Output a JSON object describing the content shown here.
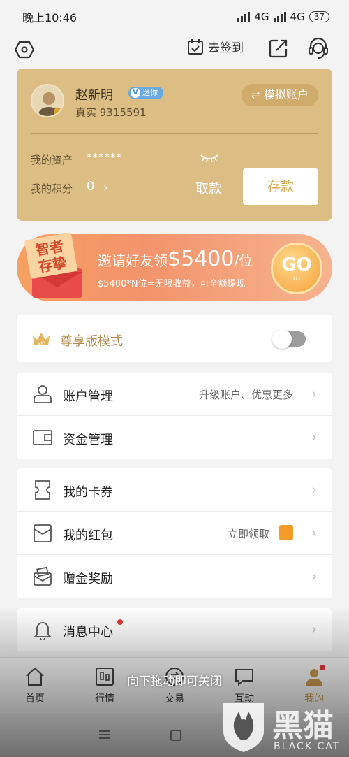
{
  "status_bar": {
    "time": "晚上10:46",
    "network1": "4G",
    "network2": "4G",
    "battery": "37"
  },
  "top_nav": {
    "sign_in_label": "去签到"
  },
  "account": {
    "name": "赵新明",
    "badge": "迷你",
    "badge_v": "V",
    "id_text": "真实 9315591",
    "simulated_label": "⇌ 模拟账户",
    "asset_label": "我的资产",
    "asset_value": "******",
    "points_label": "我的积分",
    "points_value": "0",
    "withdraw_label": "取款",
    "deposit_label": "存款"
  },
  "banner": {
    "badge_line1": "智者",
    "badge_line2": "存挚",
    "title_prefix": "邀请好友领",
    "title_amount": "$5400",
    "title_suffix": "/位",
    "subtitle": "$5400*N位=无限收益，可全额提现",
    "go_label": "GO",
    "go_arrows": "›››"
  },
  "vip_mode": {
    "label": "尊享版模式",
    "crown_text": "VIP",
    "enabled": false
  },
  "menu_group1": [
    {
      "label": "账户管理",
      "extra": "升级账户、优惠更多"
    },
    {
      "label": "资金管理",
      "extra": ""
    }
  ],
  "menu_group2": [
    {
      "label": "我的卡券",
      "extra": ""
    },
    {
      "label": "我的红包",
      "extra": "立即领取"
    },
    {
      "label": "赠金奖励",
      "extra": ""
    }
  ],
  "menu_group3": [
    {
      "label": "消息中心",
      "extra": ""
    }
  ],
  "tabs": [
    {
      "label": "首页"
    },
    {
      "label": "行情"
    },
    {
      "label": "交易"
    },
    {
      "label": "互动"
    },
    {
      "label": "我的"
    }
  ],
  "drag_hint": "向下拖动即可关闭",
  "watermark": {
    "title": "黑猫",
    "subtitle": "BLACK CAT"
  },
  "colors": {
    "gold": "#dcbd83",
    "accent": "#d7a84f",
    "banner": "#f3936b",
    "red": "#e53935"
  }
}
